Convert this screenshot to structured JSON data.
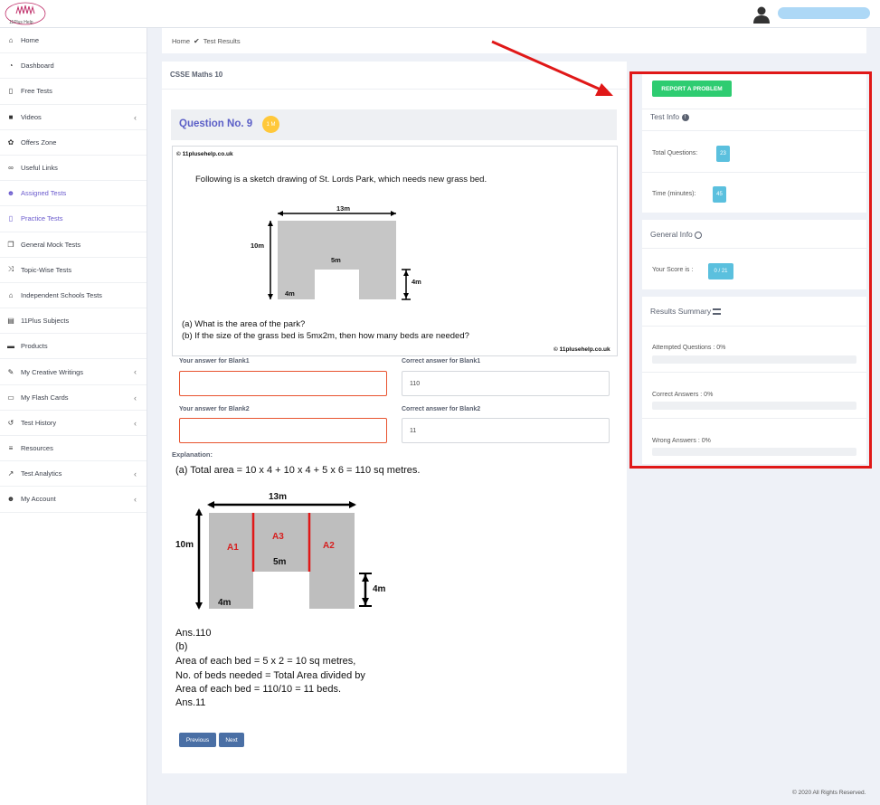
{
  "app": {
    "logo_text": "11Plus Help"
  },
  "sidebar": {
    "items": [
      {
        "label": "Home",
        "icon": "home-icon",
        "glyph": "⌂",
        "chevron": false
      },
      {
        "label": "Dashboard",
        "icon": "dashboard-icon",
        "glyph": "◔",
        "chevron": false
      },
      {
        "label": "Free Tests",
        "icon": "document-icon",
        "glyph": "▯",
        "chevron": false
      },
      {
        "label": "Videos",
        "icon": "video-icon",
        "glyph": "■",
        "chevron": true
      },
      {
        "label": "Offers Zone",
        "icon": "gift-icon",
        "glyph": "✿",
        "chevron": false
      },
      {
        "label": "Useful Links",
        "icon": "link-icon",
        "glyph": "∞",
        "chevron": false
      },
      {
        "label": "Assigned Tests",
        "icon": "users-icon",
        "glyph": "☻",
        "chevron": false,
        "highlight": true
      },
      {
        "label": "Practice Tests",
        "icon": "document-icon",
        "glyph": "▯",
        "chevron": false,
        "highlight": true
      },
      {
        "label": "General Mock Tests",
        "icon": "copy-icon",
        "glyph": "❐",
        "chevron": false
      },
      {
        "label": "Topic-Wise Tests",
        "icon": "shuffle-icon",
        "glyph": "⤨",
        "chevron": false
      },
      {
        "label": "Independent Schools Tests",
        "icon": "school-icon",
        "glyph": "⌂",
        "chevron": false
      },
      {
        "label": "11Plus Subjects",
        "icon": "book-icon",
        "glyph": "▤",
        "chevron": false
      },
      {
        "label": "Products",
        "icon": "briefcase-icon",
        "glyph": "▬",
        "chevron": false
      },
      {
        "label": "My Creative Writings",
        "icon": "pencil-icon",
        "glyph": "✎",
        "chevron": true
      },
      {
        "label": "My Flash Cards",
        "icon": "card-icon",
        "glyph": "▭",
        "chevron": true
      },
      {
        "label": "Test History",
        "icon": "history-icon",
        "glyph": "↺",
        "chevron": true
      },
      {
        "label": "Resources",
        "icon": "list-icon",
        "glyph": "≡",
        "chevron": false
      },
      {
        "label": "Test Analytics",
        "icon": "chart-icon",
        "glyph": "↗",
        "chevron": true
      },
      {
        "label": "My Account",
        "icon": "user-icon",
        "glyph": "☻",
        "chevron": true
      }
    ]
  },
  "breadcrumb": {
    "home": "Home",
    "current": "Test Results"
  },
  "test": {
    "title": "CSSE Maths 10",
    "question_title": "Question No. 9",
    "marks_badge": "1 M"
  },
  "question": {
    "watermark": "© 11plusehelp.co.uk",
    "text": "Following is a sketch drawing of St. Lords Park, which needs new grass bed.",
    "dim_top": "13m",
    "dim_left": "10m",
    "dim_inner": "5m",
    "dim_notch": "4m",
    "dim_base": "4m",
    "part_a": "(a) What is the area of the park?",
    "part_b": "(b) If the size of the grass bed is 5mx2m, then how many beds are needed?"
  },
  "answers": {
    "blank1_label": "Your answer for Blank1",
    "blank1_correct_label": "Correct answer for Blank1",
    "blank1_correct": "110",
    "blank2_label": "Your answer for Blank2",
    "blank2_correct_label": "Correct answer for Blank2",
    "blank2_correct": "11"
  },
  "explanation": {
    "label": "Explanation:",
    "line1": "(a) Total area = 10 x 4 + 10 x 4 + 5 x 6 = 110 sq metres.",
    "a1": "A1",
    "a2": "A2",
    "a3": "A3",
    "lines": [
      "Ans.110",
      " (b)",
      "Area of each bed = 5 x 2 = 10 sq metres,",
      "No. of beds needed = Total Area divided by",
      "Area of each bed = 110/10 = 11 beds.",
      "Ans.11"
    ]
  },
  "nav": {
    "previous": "Previous",
    "next": "Next"
  },
  "right_panel": {
    "report_button": "REPORT A PROBLEM",
    "test_info_title": "Test Info",
    "total_questions_label": "Total Questions:",
    "total_questions": "23",
    "time_label": "Time (minutes):",
    "time": "45",
    "general_info_title": "General Info",
    "score_label": "Your Score is :",
    "score": "0 / 21",
    "results_title": "Results Summary",
    "attempted": "Attempted Questions : 0%",
    "correct": "Correct Answers : 0%",
    "wrong": "Wrong Answers : 0%",
    "attempted_pct": 0,
    "correct_pct": 0,
    "wrong_pct": 0
  },
  "footer": "© 2020 All Rights Reserved.",
  "colors": {
    "accent": "#5b5fc7",
    "highlight": "#e01818",
    "report": "#2ecc71",
    "pill": "#5bc0de",
    "nav": "#4a6fa5"
  }
}
